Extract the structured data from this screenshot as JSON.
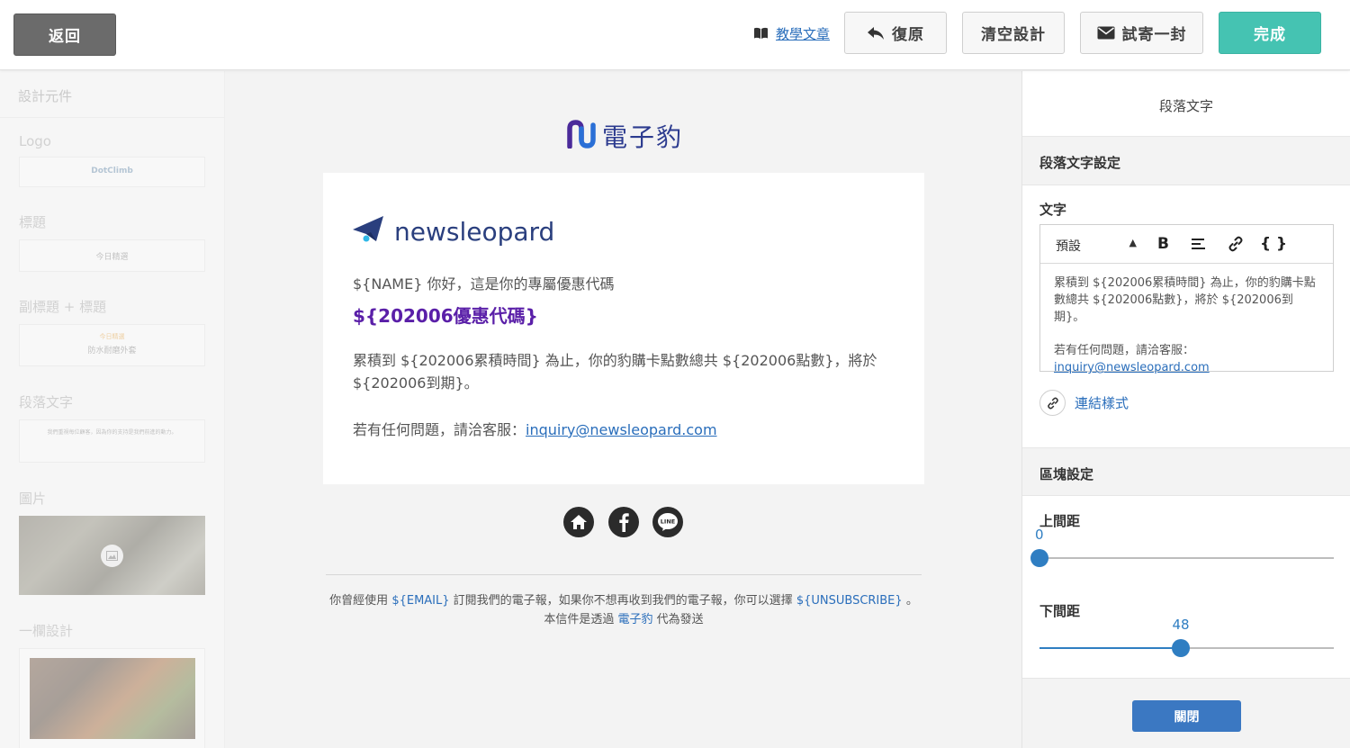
{
  "topbar": {
    "back_label": "返回",
    "tutorial_label": "教學文章",
    "undo_label": "復原",
    "clear_label": "清空設計",
    "test_label": "試寄一封",
    "done_label": "完成",
    "accent_color": "#45c3b2"
  },
  "sidebar": {
    "header": "設計元件",
    "sections": [
      {
        "label": "Logo",
        "preview": "DotClimb"
      },
      {
        "label": "標題",
        "preview": "今日精選"
      },
      {
        "label": "副標題 + 標題",
        "preview_sub": "今日精選",
        "preview": "防水耐磨外套"
      },
      {
        "label": "段落文字",
        "preview": "我們重視每位顧客，因為你的支持是我們前進的動力。"
      },
      {
        "label": "圖片"
      },
      {
        "label": "一欄設計"
      }
    ]
  },
  "canvas": {
    "brand_name": "電子豹",
    "card": {
      "logo_text": "newsleopard",
      "greeting": "${NAME} 你好，這是你的專屬優惠代碼",
      "coupon": "${202006優惠代碼}",
      "paragraph": "累積到 ${202006累積時間} 為止，你的豹購卡點數總共 ${202006點數}，將於 ${202006到期}。",
      "contact_prefix": "若有任何問題，請洽客服：",
      "contact_email": "inquiry@newsleopard.com",
      "coupon_color": "#5a1fa8"
    },
    "social": [
      "home-icon",
      "facebook-icon",
      "line-icon"
    ],
    "footer": {
      "line1_a": "你曾經使用",
      "line1_email_var": "${EMAIL}",
      "line1_b": "訂閱我們的電子報，如果你不想再收到我們的電子報，你可以選擇",
      "line1_unsub_var": "${UNSUBSCRIBE}",
      "line1_c": "。",
      "line2_a": "本信件是透過",
      "line2_brand": "電子豹",
      "line2_b": "代為發送"
    }
  },
  "panel": {
    "title": "段落文字",
    "text_settings_header": "段落文字設定",
    "text_label": "文字",
    "editor": {
      "format_select": "預設",
      "bold_label": "B",
      "var_label": "{ }",
      "content_line1": "累積到 ${202006累積時間} 為止，你的豹購卡點數總共 ${202006點數}，將於 ${202006到期}。",
      "content_line2": "若有任何問題，請洽客服：",
      "content_email": "inquiry@newsleopard.com"
    },
    "link_style_label": "連結樣式",
    "block_settings_header": "區塊設定",
    "top_padding": {
      "label": "上間距",
      "value": "0",
      "fraction": 0
    },
    "bottom_padding": {
      "label": "下間距",
      "value": "48",
      "fraction": 0.48
    },
    "close_label": "關閉",
    "slider_color": "#2f7ec2"
  }
}
